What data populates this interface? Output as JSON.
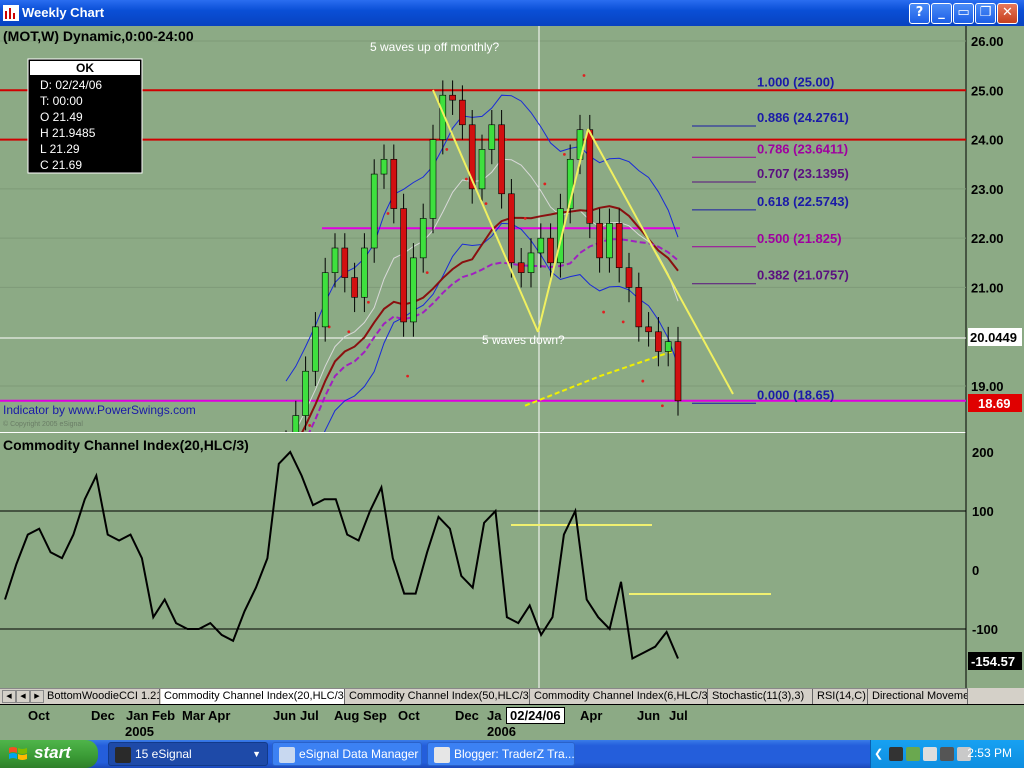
{
  "window": {
    "title": "Weekly Chart"
  },
  "price_pane": {
    "symbol_label": "(MOT,W) Dynamic,0:00-24:00",
    "annotation_top": "5 waves up off monthly?",
    "annotation_mid": "5 waves down?",
    "indicator_credit": "Indicator by www.PowerSwings.com",
    "copyright": "© Copyright 2005 eSignal",
    "last_price_label": "18.69",
    "cursor_price_label": "20.0449",
    "y_ticks": [
      "26.00",
      "25.00",
      "24.00",
      "23.00",
      "22.00",
      "21.00",
      "19.00"
    ],
    "data_window": {
      "status": "OK",
      "lines": [
        "D: 02/24/06",
        "T: 00:00",
        "O 21.49",
        "H 21.9485",
        "L 21.29",
        "C 21.69"
      ]
    },
    "fib_levels": [
      {
        "label": "1.000 (25.00)",
        "value": 25.0,
        "color": "#1a1aa8"
      },
      {
        "label": "0.886 (24.2761)",
        "value": 24.2761,
        "color": "#1a1aa8"
      },
      {
        "label": "0.786 (23.6411)",
        "value": 23.6411,
        "color": "#a000a0"
      },
      {
        "label": "0.707 (23.1395)",
        "value": 23.1395,
        "color": "#5a1080"
      },
      {
        "label": "0.618 (22.5743)",
        "value": 22.5743,
        "color": "#1a1aa8"
      },
      {
        "label": "0.500 (21.825)",
        "value": 21.825,
        "color": "#a000a0"
      },
      {
        "label": "0.382 (21.0757)",
        "value": 21.0757,
        "color": "#5a1080"
      },
      {
        "label": "0.000 (18.65)",
        "value": 18.65,
        "color": "#1a1aa8"
      }
    ]
  },
  "cci_pane": {
    "title": "Commodity Channel Index(20,HLC/3)",
    "current_value_label": "-154.57",
    "y_ticks": [
      "200",
      "100",
      "0",
      "-100"
    ]
  },
  "tabs": [
    {
      "label": "BottomWoodieCCI 1.21",
      "active": false
    },
    {
      "label": "Commodity Channel Index(20,HLC/3)",
      "active": true
    },
    {
      "label": "Commodity Channel Index(50,HLC/3)",
      "active": false
    },
    {
      "label": "Commodity Channel Index(6,HLC/3)",
      "active": false
    },
    {
      "label": "Stochastic(11(3),3)",
      "active": false
    },
    {
      "label": "RSI(14,C)",
      "active": false
    },
    {
      "label": "Directional Moveme",
      "active": false
    }
  ],
  "time_axis": {
    "months": [
      "Oct",
      "Dec",
      "Jan",
      "Feb",
      "Mar",
      "Apr",
      "Jun",
      "Jul",
      "Aug",
      "Sep",
      "Oct",
      "Dec",
      "Ja",
      "Apr",
      "Jun",
      "Jul"
    ],
    "years": [
      "2005",
      "2006"
    ],
    "cursor_date": "02/24/06"
  },
  "chart_data": [
    {
      "type": "candlestick",
      "title": "(MOT,W) Dynamic,0:00-24:00",
      "ylim": [
        18.4,
        26.3
      ],
      "horizontal_lines": [
        25.0,
        24.0,
        22.2,
        18.7
      ],
      "approx_close_path": [
        17.8,
        18.4,
        19.3,
        20.2,
        21.3,
        21.8,
        21.2,
        20.8,
        21.8,
        23.3,
        23.6,
        22.6,
        20.3,
        21.6,
        22.4,
        24.0,
        24.9,
        24.8,
        24.3,
        23.0,
        23.8,
        24.3,
        22.9,
        21.5,
        21.3,
        21.7,
        22.0,
        21.5,
        22.6,
        23.6,
        24.2,
        22.3,
        21.6,
        22.3,
        21.4,
        21.0,
        20.2,
        20.1,
        19.7,
        19.9,
        18.7
      ],
      "annotations": [
        "5 waves up off monthly?",
        "5 waves down?"
      ]
    },
    {
      "type": "line",
      "title": "Commodity Channel Index(20,HLC/3)",
      "ylim": [
        -190,
        220
      ],
      "approx_values": [
        -50,
        10,
        60,
        70,
        30,
        20,
        60,
        120,
        160,
        60,
        50,
        60,
        20,
        -80,
        -50,
        -90,
        -100,
        -100,
        -90,
        -110,
        -120,
        -70,
        -30,
        20,
        180,
        200,
        160,
        110,
        120,
        120,
        60,
        50,
        100,
        140,
        20,
        -40,
        -40,
        30,
        90,
        70,
        -10,
        -30,
        80,
        100,
        -80,
        -90,
        -60,
        -110,
        -80,
        60,
        100,
        -50,
        -80,
        -100,
        -20,
        -150,
        -140,
        -130,
        -105,
        -150
      ]
    }
  ]
}
